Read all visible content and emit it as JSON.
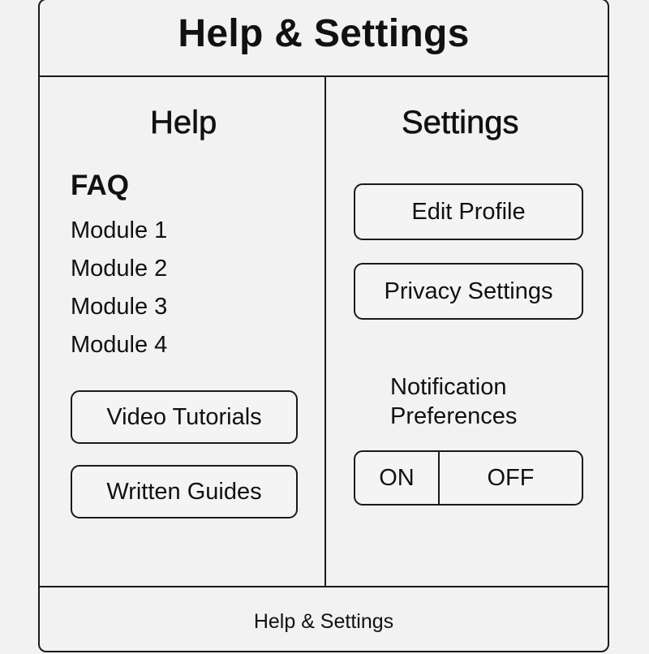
{
  "header": {
    "title": "Help & Settings"
  },
  "help": {
    "title": "Help",
    "faq_heading": "FAQ",
    "modules": [
      "Module 1",
      "Module 2",
      "Module 3",
      "Module 4"
    ],
    "buttons": {
      "video_tutorials": "Video Tutorials",
      "written_guides": "Written Guides"
    }
  },
  "settings": {
    "title": "Settings",
    "buttons": {
      "edit_profile": "Edit Profile",
      "privacy_settings": "Privacy Settings"
    },
    "notification_label_line1": "Notification",
    "notification_label_line2": "Preferences",
    "toggle": {
      "on_label": "ON",
      "off_label": "OFF"
    }
  },
  "footer": {
    "text": "Help & Settings"
  },
  "colors": {
    "background": "#f2f2f2",
    "border": "#1a1a1a",
    "text": "#111111"
  }
}
